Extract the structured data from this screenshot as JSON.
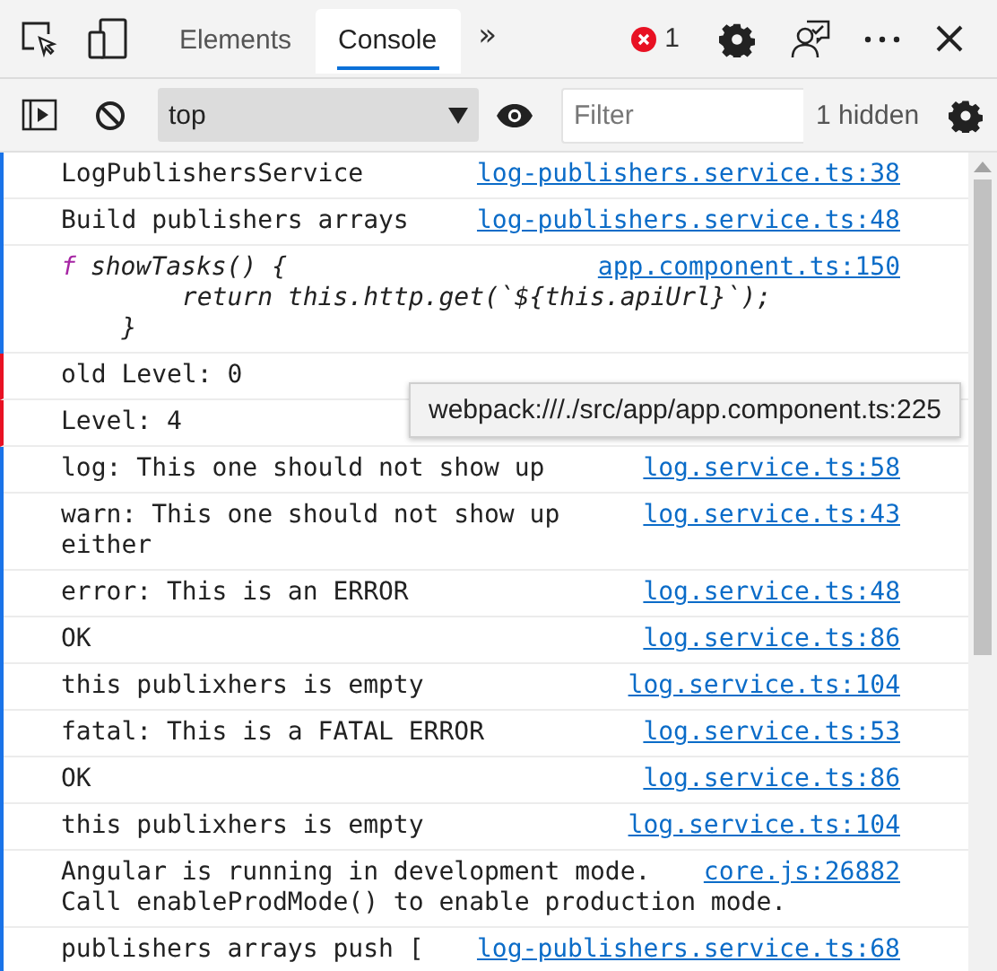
{
  "tabs": [
    {
      "label": "Elements",
      "selected": false
    },
    {
      "label": "Console",
      "selected": true
    }
  ],
  "overflow": "»",
  "error_count": "1",
  "toolbar": {
    "context": "top",
    "filter": {
      "placeholder": "Filter"
    },
    "hidden_count": "1 hidden"
  },
  "messages": [
    {
      "kind": "text",
      "lines": [
        "LogPublishersService"
      ],
      "source": "log-publishers.service.ts:38",
      "flagged": false
    },
    {
      "kind": "text",
      "lines": [
        "Build publishers arrays"
      ],
      "source": "log-publishers.service.ts:48",
      "flagged": false
    },
    {
      "kind": "function",
      "prefix": "f",
      "lines": [
        "showTasks() {",
        "        return this.http.get(`${this.apiUrl}`);",
        "    }"
      ],
      "source": "app.component.ts:150",
      "flagged": false
    },
    {
      "kind": "text",
      "lines": [
        "old Level: 0"
      ],
      "flagged": true
    },
    {
      "kind": "text",
      "lines": [
        "Level: 4"
      ],
      "flagged": true
    },
    {
      "kind": "text",
      "lines": [
        "log: This one should not show up"
      ],
      "source": "log.service.ts:58",
      "flagged": false
    },
    {
      "kind": "text",
      "lines": [
        "warn: This one should not show up either"
      ],
      "source": "log.service.ts:43",
      "flagged": false
    },
    {
      "kind": "text",
      "lines": [
        "error: This is an ERROR"
      ],
      "source": "log.service.ts:48",
      "flagged": false
    },
    {
      "kind": "text",
      "lines": [
        "OK"
      ],
      "source": "log.service.ts:86",
      "flagged": false
    },
    {
      "kind": "text",
      "lines": [
        "this publixhers is empty"
      ],
      "source": "log.service.ts:104",
      "flagged": false
    },
    {
      "kind": "text",
      "lines": [
        "fatal: This is a FATAL ERROR"
      ],
      "source": "log.service.ts:53",
      "flagged": false
    },
    {
      "kind": "text",
      "lines": [
        "OK"
      ],
      "source": "log.service.ts:86",
      "flagged": false
    },
    {
      "kind": "text",
      "lines": [
        "this publixhers is empty"
      ],
      "source": "log.service.ts:104",
      "flagged": false
    },
    {
      "kind": "text",
      "lines": [
        "Angular is running in development mode.",
        "Call enableProdMode() to enable production mode."
      ],
      "source": "core.js:26882",
      "flagged": false
    },
    {
      "kind": "text",
      "lines": [
        "publishers arrays push ["
      ],
      "source": "log-publishers.service.ts:68",
      "flagged": false
    }
  ],
  "tooltip": "webpack:///./src/app/app.component.ts:225"
}
